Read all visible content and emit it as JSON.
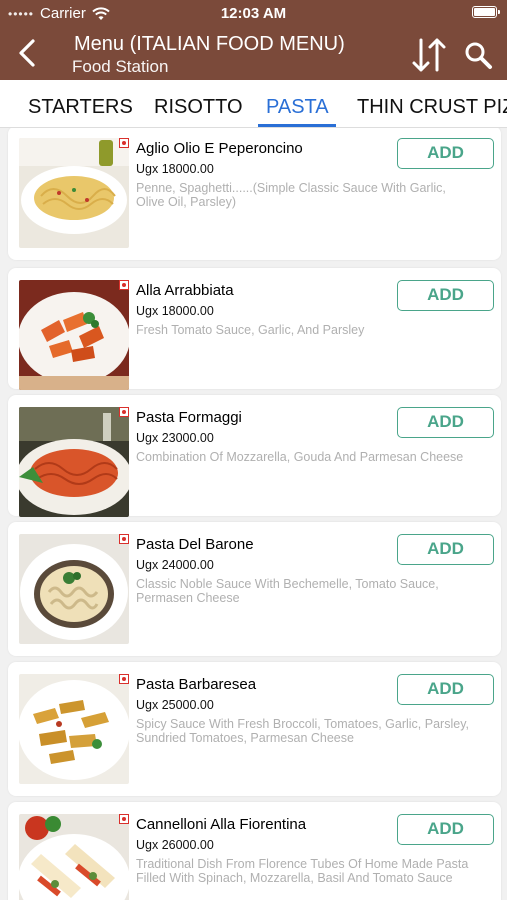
{
  "status_bar": {
    "carrier": "Carrier",
    "time": "12:03 AM"
  },
  "header": {
    "title": "Menu (ITALIAN FOOD MENU)",
    "subtitle": "Food Station"
  },
  "tabs": [
    {
      "label": "STARTERS"
    },
    {
      "label": "RISOTTO"
    },
    {
      "label": "PASTA"
    },
    {
      "label": "THIN CRUST PIZ"
    }
  ],
  "active_tab": "PASTA",
  "add_label": "ADD",
  "items": [
    {
      "name": "Aglio Olio E Peperoncino",
      "price": "Ugx 18000.00",
      "description": "Penne, Spaghetti......(Simple Classic Sauce With Garlic, Olive Oil, Parsley)"
    },
    {
      "name": "Alla Arrabbiata",
      "price": "Ugx 18000.00",
      "description": "Fresh Tomato Sauce, Garlic, And Parsley"
    },
    {
      "name": "Pasta Formaggi",
      "price": "Ugx 23000.00",
      "description": "Combination Of Mozzarella, Gouda And Parmesan Cheese"
    },
    {
      "name": "Pasta Del Barone",
      "price": "Ugx 24000.00",
      "description": "Classic Noble Sauce With Bechemelle, Tomato Sauce, Permasen Cheese"
    },
    {
      "name": "Pasta Barbaresea",
      "price": "Ugx 25000.00",
      "description": "Spicy Sauce With Fresh Broccoli, Tomatoes, Garlic, Parsley, Sundried Tomatoes, Parmesan Cheese"
    },
    {
      "name": "Cannelloni Alla Fiorentina",
      "price": "Ugx 26000.00",
      "description": "Traditional Dish From Florence Tubes Of Home Made Pasta Filled With Spinach, Mozzarella, Basil And Tomato Sauce"
    }
  ],
  "colors": {
    "header": "#7b4a3a",
    "tab_active": "#2a6fd6",
    "add_button": "#4aa58a",
    "veg_dot": "#d9302c"
  },
  "icons": {
    "back": "chevron-left-icon",
    "sort": "sort-arrows-icon",
    "search": "search-icon",
    "veg": "veg-indicator-icon"
  }
}
